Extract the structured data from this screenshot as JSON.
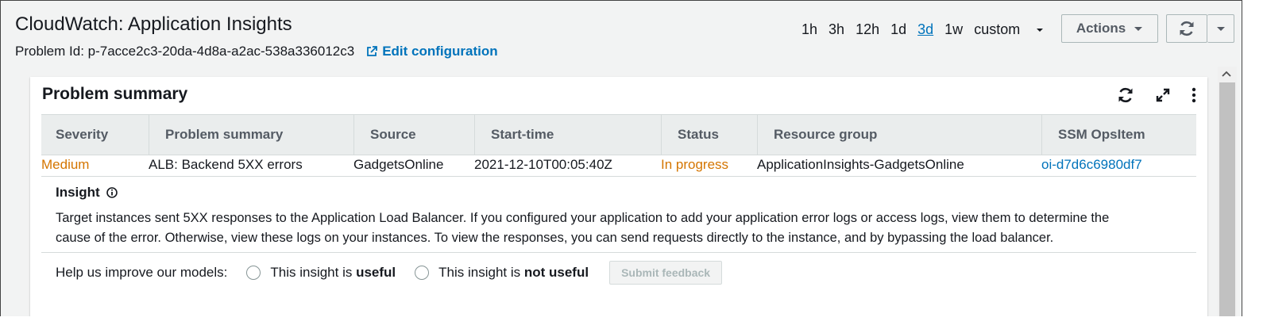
{
  "header": {
    "title": "CloudWatch: Application Insights",
    "problem_id": "Problem Id: p-7acce2c3-20da-4d8a-a2ac-538a336012c3",
    "edit_label": "Edit configuration"
  },
  "time_ranges": {
    "items": [
      "1h",
      "3h",
      "12h",
      "1d",
      "3d",
      "1w"
    ],
    "active": "3d",
    "custom_label": "custom"
  },
  "toolbar": {
    "actions_label": "Actions"
  },
  "panel": {
    "title": "Problem summary",
    "columns": [
      "Severity",
      "Problem summary",
      "Source",
      "Start-time",
      "Status",
      "Resource group",
      "SSM OpsItem"
    ],
    "row": {
      "severity": "Medium",
      "summary": "ALB: Backend 5XX errors",
      "source": "GadgetsOnline",
      "start_time": "2021-12-10T00:05:40Z",
      "status": "In progress",
      "resource_group": "ApplicationInsights-GadgetsOnline",
      "ops_item": "oi-d7d6c6980df7"
    },
    "insight": {
      "heading": "Insight",
      "line1": "Target instances sent 5XX responses to the Application Load Balancer. If you configured your application to add your application error logs or access logs, view them to determine the",
      "line2": "cause of the error. Otherwise, view these logs on your instances. To view the responses, you can send requests directly to the instance, and by bypassing the load balancer."
    },
    "feedback": {
      "prompt": "Help us improve our models:",
      "useful_prefix": "This insight is ",
      "useful_bold": "useful",
      "not_useful_prefix": "This insight is ",
      "not_useful_bold": "not useful",
      "submit_label": "Submit feedback"
    }
  },
  "colors": {
    "link": "#0073bb",
    "warning": "#d47500",
    "header_bg": "#eaeded"
  }
}
